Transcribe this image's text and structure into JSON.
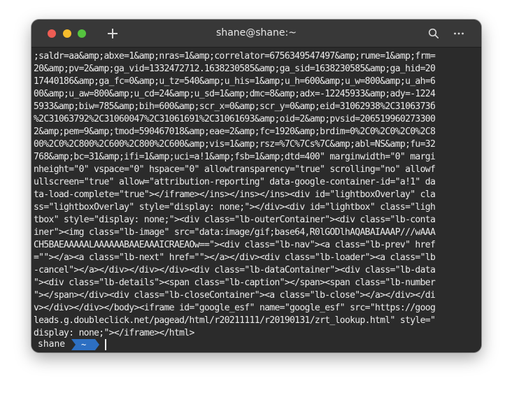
{
  "window": {
    "title": "shane@shane:~"
  },
  "terminal": {
    "lines": [
      ";saldr=aa&amp;abxe=1&amp;nras=1&amp;correlator=6756349547497&amp;rume=1&amp;frm=",
      "20&amp;pv=2&amp;ga_vid=1332472712.1638230585&amp;ga_sid=1638230585&amp;ga_hid=20",
      "17440186&amp;ga_fc=0&amp;u_tz=540&amp;u_his=1&amp;u_h=600&amp;u_w=800&amp;u_ah=6",
      "00&amp;u_aw=800&amp;u_cd=24&amp;u_sd=1&amp;dmc=8&amp;adx=-12245933&amp;ady=-1224",
      "5933&amp;biw=785&amp;bih=600&amp;scr_x=0&amp;scr_y=0&amp;eid=31062938%2C3106373б",
      "%2C31063792%2C31060047%2C31061691%2C31061693&amp;oid=2&amp;pvsid=206519960273300",
      "2&amp;pem=9&amp;tmod=590467018&amp;eae=2&amp;fc=1920&amp;brdim=0%2C0%2C0%2C0%2C8",
      "00%2C0%2C800%2C600%2C800%2C600&amp;vis=1&amp;rsz=%7C%7Cs%7C&amp;abl=NS&amp;fu=32",
      "768&amp;bc=31&amp;ifi=1&amp;uci=a!1&amp;fsb=1&amp;dtd=400\" marginwidth=\"0\" margi",
      "nheight=\"0\" vspace=\"0\" hspace=\"0\" allowtransparency=\"true\" scrolling=\"no\" allowf",
      "ullscreen=\"true\" allow=\"attribution-reporting\" data-google-container-id=\"a!1\" da",
      "ta-load-complete=\"true\"></iframe></ins></ins></ins><div id=\"lightboxOverlay\" cla",
      "ss=\"lightboxOverlay\" style=\"display: none;\"></div><div id=\"lightbox\" class=\"ligh",
      "tbox\" style=\"display: none;\"><div class=\"lb-outerContainer\"><div class=\"lb-conta",
      "iner\"><img class=\"lb-image\" src=\"data:image/gif;base64,R0lGODlhAQABAIAAAP///wAAA",
      "CH5BAEAAAAALAAAAAABAAEAAAICRAEAOw==\"><div class=\"lb-nav\"><a class=\"lb-prev\" href",
      "=\"\"></a><a class=\"lb-next\" href=\"\"></a></div><div class=\"lb-loader\"><a class=\"lb",
      "-cancel\"></a></div></div></div><div class=\"lb-dataContainer\"><div class=\"lb-data",
      "\"><div class=\"lb-details\"><span class=\"lb-caption\"></span><span class=\"lb-number",
      "\"></span></div><div class=\"lb-closeContainer\"><a class=\"lb-close\"></a></div></di",
      "v></div></div></body><iframe id=\"google_esf\" name=\"google_esf\" src=\"https://goog",
      "leads.g.doubleclick.net/pagead/html/r20211111/r20190131/zrt_lookup.html\" style=\"",
      "display: none;\"></iframe></html>"
    ],
    "prompt": {
      "user": "shane",
      "dir": "~"
    }
  },
  "colors": {
    "titlebar": "#383838",
    "terminal_bg": "#2b2b2b",
    "text": "#ececec",
    "prompt_dir_bg": "#2d6fc2",
    "close": "#ee5d54",
    "minimize": "#f6bc2c",
    "maximize": "#55c43f"
  },
  "icons": {
    "new_tab": "plus-icon",
    "search": "search-icon",
    "menu": "ellipsis-icon"
  }
}
